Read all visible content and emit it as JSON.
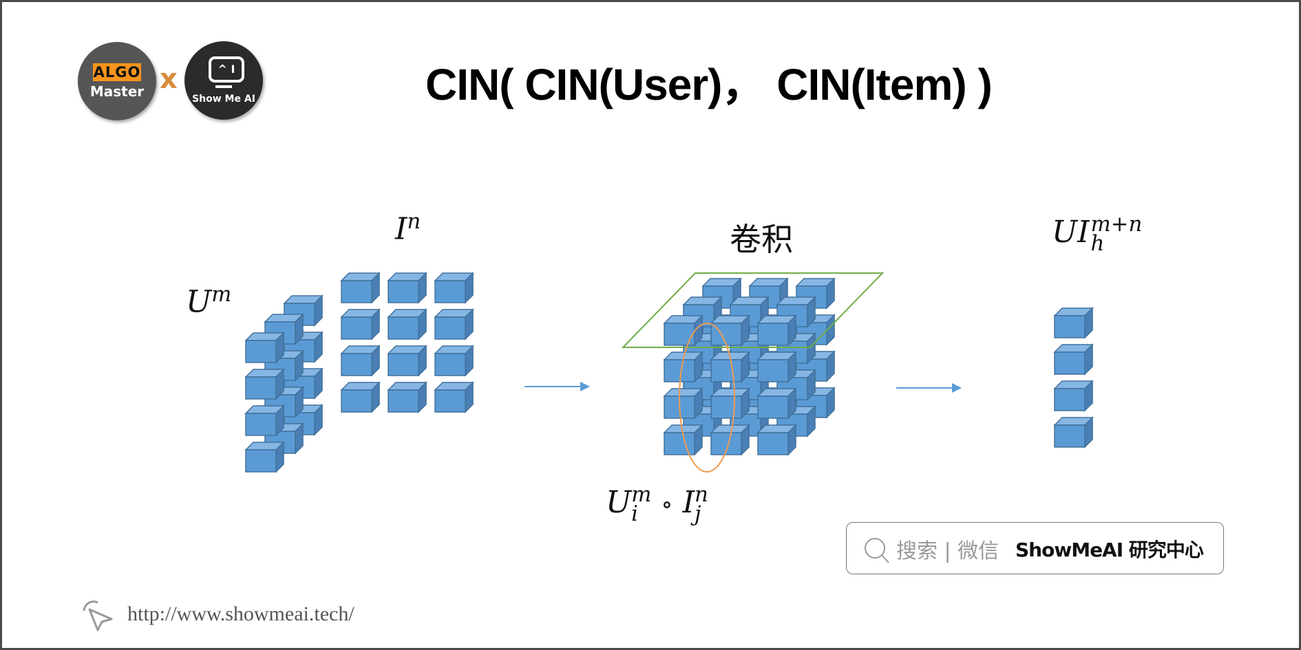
{
  "logos": {
    "algo_tag": "ALGO",
    "algo_master": "Master",
    "separator": "x",
    "smai_screen": "^ I",
    "smai_text": "Show Me AI"
  },
  "title": "CIN( CIN(User)， CIN(Item) )",
  "diagram": {
    "user_label": {
      "base": "U",
      "sup": "m"
    },
    "item_label": {
      "base": "I",
      "sup": "n"
    },
    "conv_label": "卷积",
    "output_label": {
      "base": "UI",
      "sub": "h",
      "sup": "m+n"
    },
    "hadamard_label": {
      "left_base": "U",
      "left_sub": "i",
      "left_sup": "m",
      "op": "∘",
      "right_base": "I",
      "right_sub": "j",
      "right_sup": "n"
    },
    "user_tensor": {
      "rows": 4,
      "layers": 3
    },
    "item_matrix": {
      "rows": 4,
      "cols": 3
    },
    "conv_tensor": {
      "rows": 4,
      "cols": 3,
      "layers": 3
    },
    "output_vector": {
      "rows": 4
    },
    "colors": {
      "cube_front": "#5b9bd5",
      "cube_top": "#86b6e4",
      "cube_side": "#4a7fb5",
      "cube_stroke": "#41719c",
      "arrow": "#5b9bd5",
      "plane": "#70ad47",
      "ellipse": "#ed9b4f"
    }
  },
  "search": {
    "icon": "search-icon",
    "hint": "搜索 | 微信",
    "brand": "ShowMeAI 研究中心"
  },
  "footer": {
    "icon": "cursor-icon",
    "url": "http://www.showmeai.tech/"
  }
}
